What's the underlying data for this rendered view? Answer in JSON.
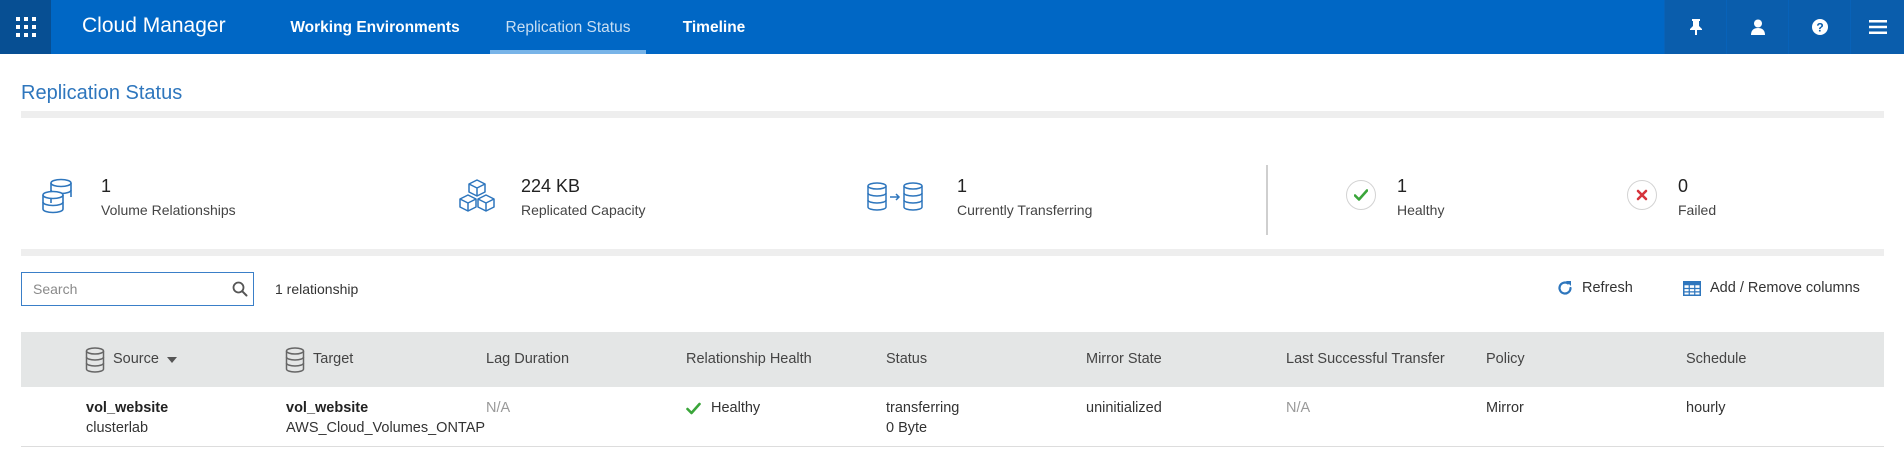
{
  "topbar": {
    "app_title": "Cloud Manager",
    "tabs": [
      {
        "label": "Working Environments",
        "active": false
      },
      {
        "label": "Replication Status",
        "active": true
      },
      {
        "label": "Timeline",
        "active": false
      }
    ],
    "icons": [
      "apps-grid-icon",
      "pin-icon",
      "user-icon",
      "help-icon",
      "menu-icon"
    ]
  },
  "page": {
    "title": "Replication Status"
  },
  "stats": [
    {
      "value": "1",
      "label": "Volume Relationships",
      "icon": "database-stack-icon"
    },
    {
      "value": "224 KB",
      "label": "Replicated Capacity",
      "icon": "cubes-icon"
    },
    {
      "value": "1",
      "label": "Currently Transferring",
      "icon": "database-transfer-icon"
    },
    {
      "value": "1",
      "label": "Healthy",
      "icon": "check-icon"
    },
    {
      "value": "0",
      "label": "Failed",
      "icon": "x-icon"
    }
  ],
  "toolbar": {
    "search_placeholder": "Search",
    "relationship_count": "1 relationship",
    "refresh_label": "Refresh",
    "columns_label": "Add / Remove columns"
  },
  "table": {
    "columns": [
      "Source",
      "Target",
      "Lag Duration",
      "Relationship Health",
      "Status",
      "Mirror State",
      "Last Successful Transfer",
      "Policy",
      "Schedule"
    ],
    "rows": [
      {
        "source_volume": "vol_website",
        "source_cluster": "clusterlab",
        "target_volume": "vol_website",
        "target_environment": "AWS_Cloud_Volumes_ONTAP",
        "lag_duration": "N/A",
        "health": "Healthy",
        "status": "transferring",
        "status_detail": "0 Byte",
        "mirror_state": "uninitialized",
        "last_transfer": "N/A",
        "policy": "Mirror",
        "schedule": "hourly"
      }
    ]
  },
  "colors": {
    "topbar": "#0067c5",
    "accent": "#2e76bd",
    "healthy": "#3aa53a",
    "failed": "#d6333b"
  }
}
